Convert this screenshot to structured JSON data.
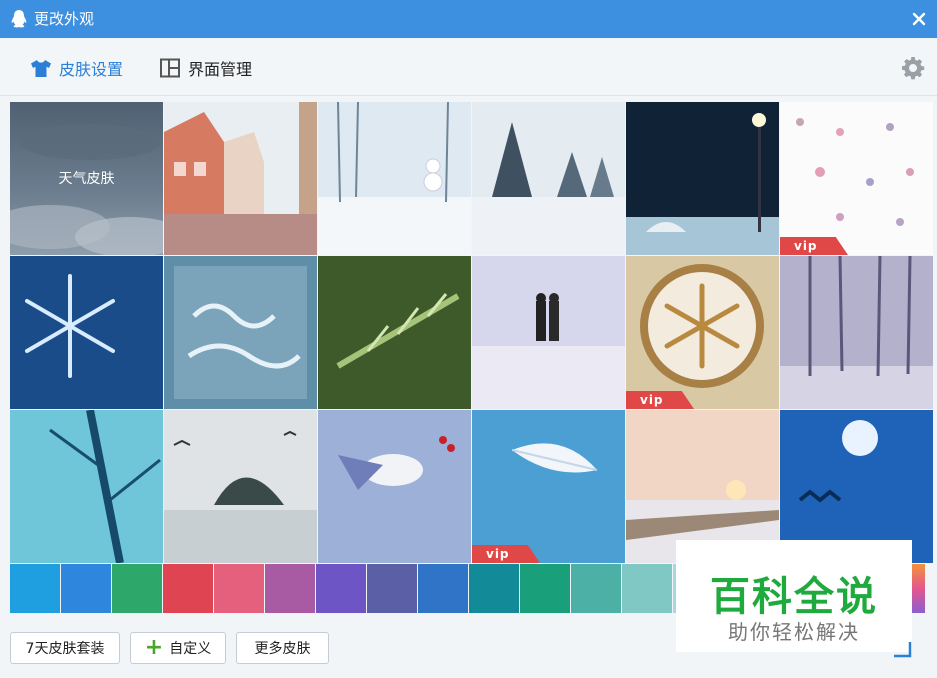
{
  "window": {
    "title": "更改外观"
  },
  "tabs": [
    {
      "label": "皮肤设置",
      "active": true
    },
    {
      "label": "界面管理",
      "active": false
    }
  ],
  "skins": [
    {
      "label": "天气皮肤",
      "vip": false,
      "selected": true
    },
    {
      "vip": false
    },
    {
      "vip": false
    },
    {
      "vip": false
    },
    {
      "vip": false
    },
    {
      "vip": true,
      "badge": "vip"
    },
    {
      "vip": false
    },
    {
      "vip": false
    },
    {
      "vip": false
    },
    {
      "vip": false
    },
    {
      "vip": true,
      "badge": "vip"
    },
    {
      "vip": false
    },
    {
      "vip": false
    },
    {
      "vip": false
    },
    {
      "vip": false
    },
    {
      "vip": true,
      "badge": "vip"
    },
    {
      "vip": false
    },
    {
      "vip": false
    }
  ],
  "swatch_colors": [
    "#1f9ee0",
    "#2f86dd",
    "#2ea86a",
    "#df4452",
    "#e5607c",
    "#a85aa2",
    "#6d55c5",
    "#5b5fa5",
    "#2f74c6",
    "#128a98",
    "#19a07b",
    "#4cb0a6",
    "#7fc8c3",
    "#a9d7e0"
  ],
  "buttons": {
    "seven_day": "7天皮肤套装",
    "custom": "自定义",
    "more": "更多皮肤"
  },
  "watermark": {
    "line1": "百科全说",
    "line2": "助你轻松解决"
  },
  "colors": {
    "accent": "#3d8fe0",
    "tab_active": "#2b7fd6",
    "vip": "#e04848"
  }
}
